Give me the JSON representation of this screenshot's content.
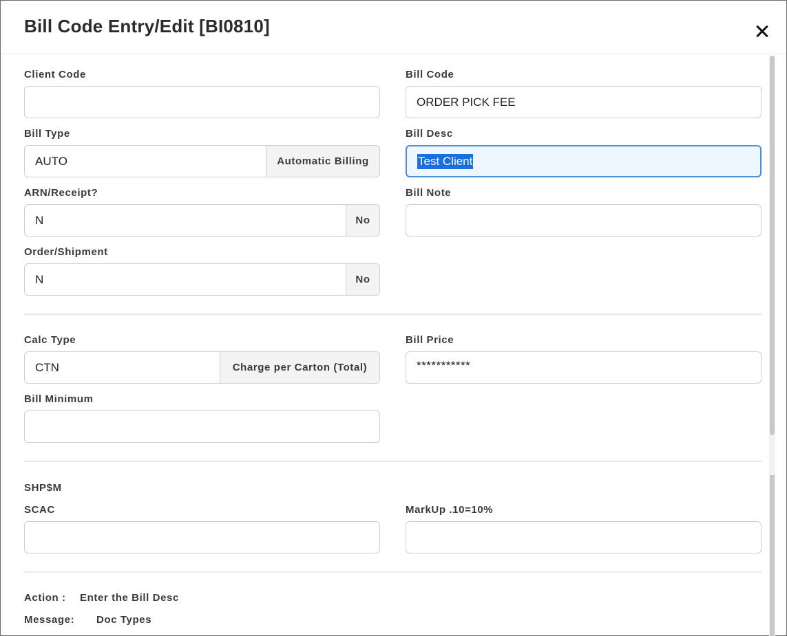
{
  "dialog": {
    "title": "Bill Code Entry/Edit [BI0810]"
  },
  "fields": {
    "client_code": {
      "label": "Client Code",
      "value": ""
    },
    "bill_code": {
      "label": "Bill Code",
      "value": "ORDER PICK FEE"
    },
    "bill_type": {
      "label": "Bill Type",
      "value": "AUTO",
      "addon": "Automatic Billing"
    },
    "bill_desc": {
      "label": "Bill Desc",
      "value": "Test Client"
    },
    "arn_receipt": {
      "label": "ARN/Receipt?",
      "value": "N",
      "addon": "No"
    },
    "bill_note": {
      "label": "Bill Note",
      "value": ""
    },
    "order_shipment": {
      "label": "Order/Shipment",
      "value": "N",
      "addon": "No"
    },
    "calc_type": {
      "label": "Calc Type",
      "value": "CTN",
      "addon": "Charge per Carton (Total)"
    },
    "bill_price": {
      "label": "Bill Price",
      "value": "***********"
    },
    "bill_minimum": {
      "label": "Bill Minimum",
      "value": ""
    },
    "scac": {
      "label": "SCAC",
      "value": ""
    },
    "markup": {
      "label": "MarkUp .10=10%",
      "value": ""
    }
  },
  "section": {
    "shp_heading": "SHP$M"
  },
  "footer": {
    "action_label": "Action :",
    "action_value": "Enter the Bill Desc",
    "message_label": "Message:",
    "message_value": "Doc Types"
  },
  "colors": {
    "focus_border": "#4a8fd8",
    "focus_bg": "#eef6ff",
    "selection": "#1a6ee0"
  }
}
